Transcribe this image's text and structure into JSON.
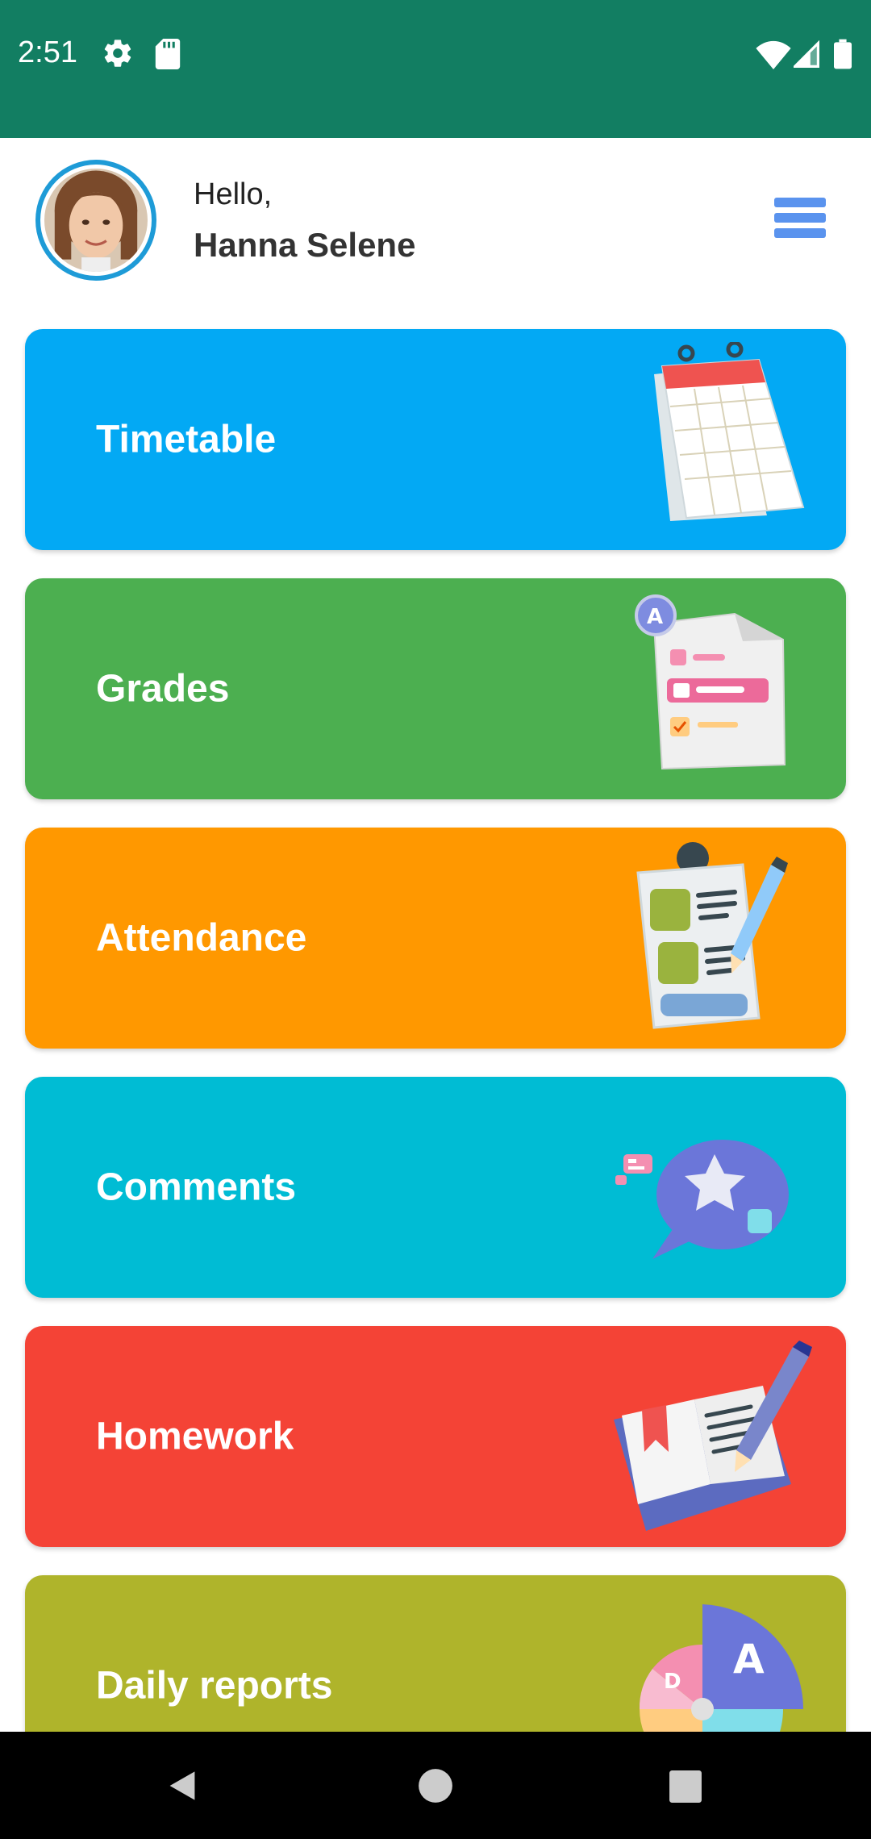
{
  "status_bar": {
    "time": "2:51",
    "icons": [
      "gear-icon",
      "sd-card-icon",
      "wifi-icon",
      "signal-icon",
      "battery-icon"
    ],
    "background": "#127e62"
  },
  "header": {
    "greeting": "Hello,",
    "user_name": "Hanna Selene",
    "menu_icon": "hamburger-menu-icon",
    "accent": "#1e9bd7"
  },
  "menu_cards": [
    {
      "label": "Timetable",
      "color": "#03a9f4",
      "icon": "calendar-icon"
    },
    {
      "label": "Grades",
      "color": "#4caf50",
      "icon": "grade-report-icon"
    },
    {
      "label": "Attendance",
      "color": "#ff9800",
      "icon": "clipboard-icon"
    },
    {
      "label": "Comments",
      "color": "#00bcd4",
      "icon": "comment-bubble-icon"
    },
    {
      "label": "Homework",
      "color": "#f44336",
      "icon": "book-pencil-icon"
    },
    {
      "label": "Daily reports",
      "color": "#afb42b",
      "icon": "pie-chart-icon"
    }
  ],
  "nav_bar": {
    "icons": [
      "back-icon",
      "home-icon",
      "recents-icon"
    ]
  }
}
